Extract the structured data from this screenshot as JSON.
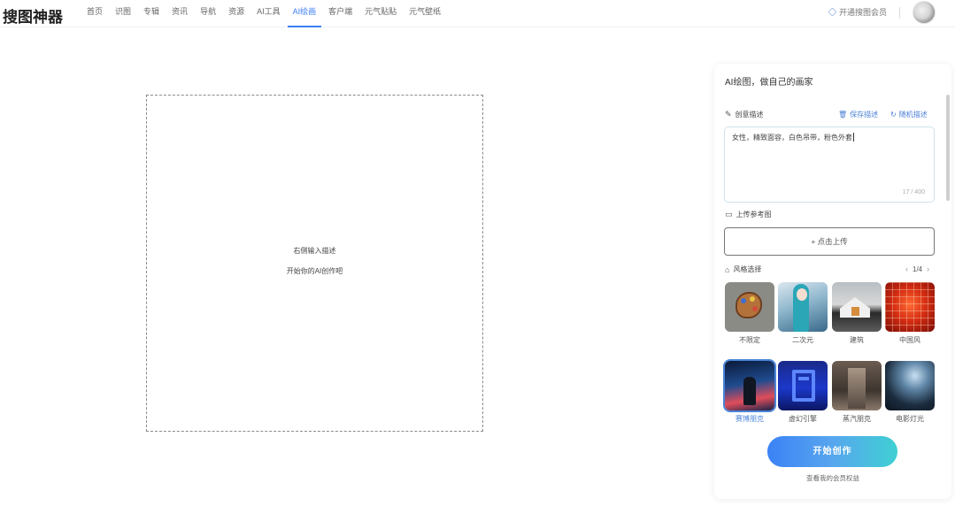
{
  "app": {
    "logo": "搜图神器"
  },
  "nav": {
    "items": [
      {
        "label": "首页",
        "active": false
      },
      {
        "label": "识图",
        "active": false
      },
      {
        "label": "专辑",
        "active": false
      },
      {
        "label": "资讯",
        "active": false
      },
      {
        "label": "导航",
        "active": false
      },
      {
        "label": "资源",
        "active": false
      },
      {
        "label": "AI工具",
        "active": false
      },
      {
        "label": "AI绘画",
        "active": true
      },
      {
        "label": "客户端",
        "active": false
      },
      {
        "label": "元气贴贴",
        "active": false
      },
      {
        "label": "元气壁纸",
        "active": false
      }
    ],
    "member_label": "开通搜图会员"
  },
  "canvas": {
    "hint_line1": "右侧输入描述",
    "hint_line2": "开始你的AI创作吧"
  },
  "panel": {
    "title": "AI绘图，做自己的画家",
    "prompt_label": "创意描述",
    "save_label": "保存描述",
    "random_label": "随机描述",
    "prompt_value": "女性，精致面容，白色吊带，粉色外套",
    "prompt_counter": "17 / 400",
    "upload_label": "上传参考图",
    "upload_button": "+ 点击上传",
    "style_label": "风格选择",
    "style_page": "1/4",
    "styles": [
      {
        "name": "不限定",
        "selected": false
      },
      {
        "name": "二次元",
        "selected": false
      },
      {
        "name": "建筑",
        "selected": false
      },
      {
        "name": "中国风",
        "selected": false
      },
      {
        "name": "赛博朋克",
        "selected": true
      },
      {
        "name": "虚幻引擎",
        "selected": false
      },
      {
        "name": "蒸汽朋克",
        "selected": false
      },
      {
        "name": "电影灯光",
        "selected": false
      }
    ],
    "start_button": "开始创作",
    "benefit_link": "查看我的会员权益"
  },
  "colors": {
    "accent": "#3d7ff4",
    "start_gradient_from": "#3b82f6",
    "start_gradient_to": "#3fd0d3"
  }
}
